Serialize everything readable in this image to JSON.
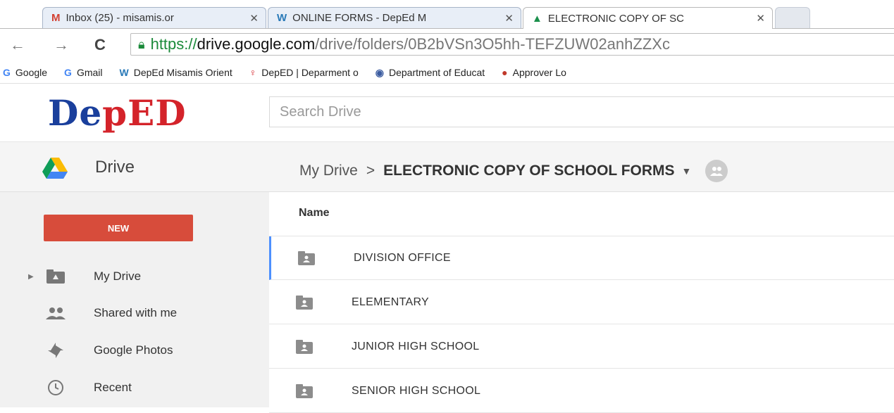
{
  "browser": {
    "tabs": [
      {
        "icon": "M",
        "title": "Inbox (25) - misamis.or",
        "close": "✕",
        "color": "#d23f31"
      },
      {
        "icon": "W",
        "title": "ONLINE FORMS - DepEd M",
        "close": "✕",
        "color": "#2a7ab8"
      },
      {
        "icon": "▲",
        "title": "ELECTRONIC COPY OF SC",
        "close": "✕",
        "color": "#1a8f4b"
      }
    ],
    "url": {
      "https": "https://",
      "domain": "drive.google.com",
      "path": "/drive/folders/0B2bVSn3O5hh-TEFZUW02anhZZXc"
    },
    "bookmarks": [
      {
        "icon": "G",
        "label": "Google",
        "color": "#4285f4"
      },
      {
        "icon": "G",
        "label": "Gmail",
        "color": "#4285f4"
      },
      {
        "icon": "W",
        "label": "DepEd Misamis Orient",
        "color": "#2a7ab8"
      },
      {
        "icon": "♀",
        "label": "DepED | Deparment o",
        "color": "#d4232a"
      },
      {
        "icon": "◉",
        "label": "Department of Educat",
        "color": "#3a5ba0"
      },
      {
        "icon": "●",
        "label": "Approver Lo",
        "color": "#c0392b"
      }
    ]
  },
  "header": {
    "logo_left": "De",
    "logo_mid": "p",
    "logo_right": "ED",
    "search_placeholder": "Search Drive"
  },
  "subheader": {
    "app_name": "Drive",
    "breadcrumb_root": "My Drive",
    "breadcrumb_sep": ">",
    "breadcrumb_current": "ELECTRONIC COPY OF SCHOOL FORMS",
    "caret": "▼"
  },
  "sidebar": {
    "new_label": "NEW",
    "items": [
      {
        "label": "My Drive"
      },
      {
        "label": "Shared with me"
      },
      {
        "label": "Google Photos"
      },
      {
        "label": "Recent"
      }
    ]
  },
  "main": {
    "column_name": "Name",
    "folders": [
      {
        "name": "DIVISION OFFICE"
      },
      {
        "name": "ELEMENTARY"
      },
      {
        "name": "JUNIOR HIGH SCHOOL"
      },
      {
        "name": "SENIOR HIGH SCHOOL"
      }
    ]
  },
  "colors": {
    "accent": "#4d90fe",
    "new_button": "#d74c3b",
    "https_green": "#1b8a3a"
  }
}
